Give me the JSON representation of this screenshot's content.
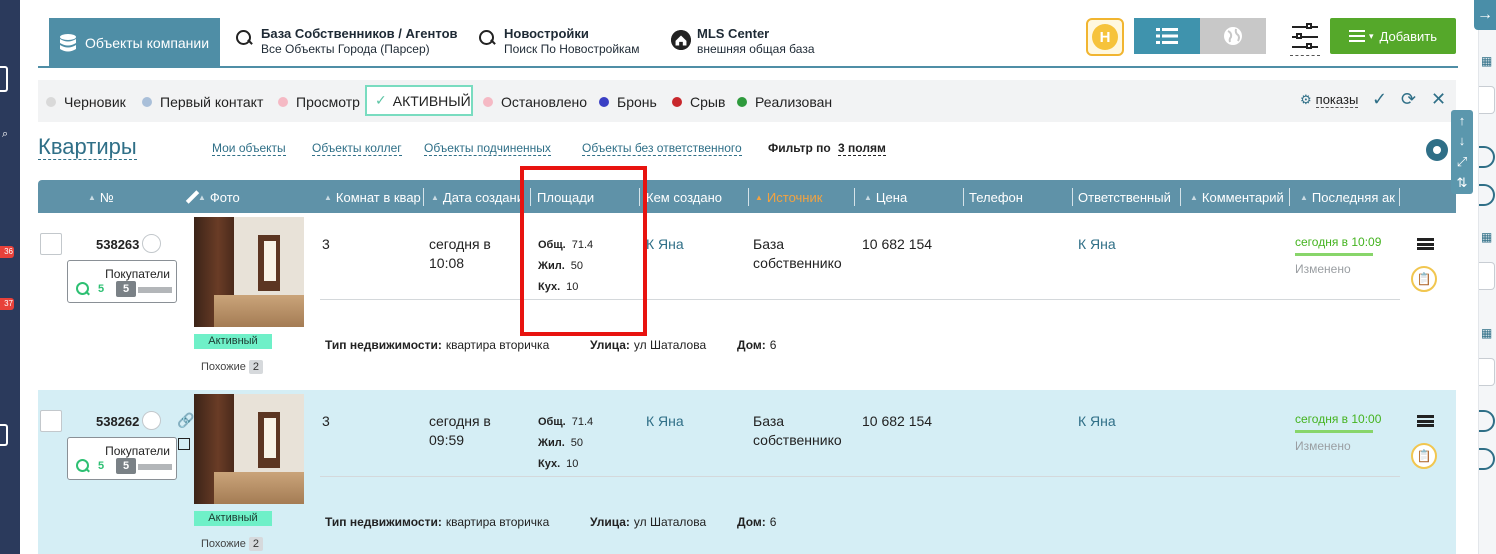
{
  "nav": {
    "active_tab": "Объекты компании",
    "links": [
      {
        "title": "База Собственников / Агентов",
        "subtitle": "Все Объекты Города (Парсер)"
      },
      {
        "title": "Новостройки",
        "subtitle": "Поиск По Новостройкам"
      },
      {
        "title": "MLS Center",
        "subtitle": "внешняя общая база"
      }
    ],
    "h_logo": "H",
    "add_label": "Добавить"
  },
  "statuses": [
    {
      "label": "Черновик",
      "color": "#d9d9d9"
    },
    {
      "label": "Первый контакт",
      "color": "#a9bfd9"
    },
    {
      "label": "Просмотр",
      "color": "#f5b9c4"
    },
    {
      "label": "АКТИВНЫЙ",
      "color": "#5bc4a4"
    },
    {
      "label": "Остановлено",
      "color": "#f5b9c4"
    },
    {
      "label": "Бронь",
      "color": "#3a3fc4"
    },
    {
      "label": "Срыв",
      "color": "#c8272c"
    },
    {
      "label": "Реализован",
      "color": "#2e9a3c"
    }
  ],
  "shows_label": "показы",
  "page": {
    "title": "Квартиры",
    "links": [
      "Мои объекты",
      "Объекты коллег",
      "Объекты подчиненных",
      "Объекты без ответственного"
    ],
    "filter_label": "Фильтр по",
    "filter_value": "3 полям"
  },
  "columns": [
    "№",
    "Фото",
    "Комнат в квар",
    "Дата создани",
    "Площади",
    "Кем создано",
    "Источник",
    "Цена",
    "Телефон",
    "Ответственный",
    "Комментарий",
    "Последняя ак"
  ],
  "rows": [
    {
      "id": "538263",
      "buyers_label": "Покупатели",
      "buyers_count": "5",
      "buyers_badge": "5",
      "status_tag": "Активный",
      "similar_label": "Похожие",
      "similar_count": "2",
      "rooms": "3",
      "created": "сегодня в 10:08",
      "area_total_label": "Общ.",
      "area_total": "71.4",
      "area_living_label": "Жил.",
      "area_living": "50",
      "area_kitchen_label": "Кух.",
      "area_kitchen": "10",
      "created_by": "К Яна",
      "source": "База собственнико",
      "price": "10 682 154",
      "phone": "",
      "responsible": "К Яна",
      "last_action": "сегодня в 10:09",
      "changed": "Изменено",
      "type_label": "Тип недвижимости:",
      "type_value": "квартира вторичка",
      "street_label": "Улица:",
      "street_value": "ул Шаталова",
      "house_label": "Дом:",
      "house_value": "6"
    },
    {
      "id": "538262",
      "buyers_label": "Покупатели",
      "buyers_count": "5",
      "buyers_badge": "5",
      "status_tag": "Активный",
      "similar_label": "Похожие",
      "similar_count": "2",
      "rooms": "3",
      "created": "сегодня в 09:59",
      "area_total_label": "Общ.",
      "area_total": "71.4",
      "area_living_label": "Жил.",
      "area_living": "50",
      "area_kitchen_label": "Кух.",
      "area_kitchen": "10",
      "created_by": "К Яна",
      "source": "База собственнико",
      "price": "10 682 154",
      "phone": "",
      "responsible": "К Яна",
      "last_action": "сегодня в 10:00",
      "changed": "Изменено",
      "type_label": "Тип недвижимости:",
      "type_value": "квартира вторичка",
      "street_label": "Улица:",
      "street_value": "ул Шаталова",
      "house_label": "Дом:",
      "house_value": "6"
    }
  ],
  "leftbar_badges": [
    "36",
    "37"
  ],
  "colors": {
    "accent": "#4f8ea6",
    "add_green": "#55a82a",
    "highlight_red": "#e8130f",
    "row_selected": "#d5eef5"
  }
}
